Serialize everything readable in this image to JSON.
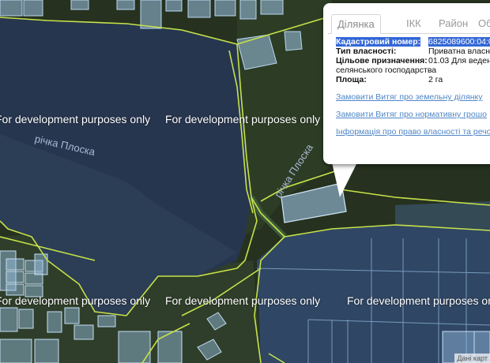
{
  "map": {
    "watermarks": [
      "For development purposes only",
      "For development purposes only",
      "For development purposes only",
      "For development purposes only",
      "For development purposes only"
    ],
    "river_labels": [
      "річка Плоска",
      "річка Плоска"
    ],
    "attribution": "Дані карт",
    "colors": {
      "parcel_fill": "#9cc3e6",
      "parcel_stroke": "#b9d7f2",
      "boundary": "#c6e24a",
      "lake": "#27364f",
      "vegetation": "#2a3a22"
    }
  },
  "popup": {
    "tabs": [
      "Ділянка",
      "ІКК",
      "Район",
      "Обл"
    ],
    "active_tab": "Ділянка",
    "fields": {
      "cadastral_label": "Кадастровий номер:",
      "cadastral_value": "6825089600:04:0",
      "ownership_label": "Тип власності:",
      "ownership_value": "Приватна власні",
      "purpose_label": "Цільове призначення:",
      "purpose_value": "01.03 Для веден",
      "purpose_cont": "селянського господарства",
      "area_label": "Площа:",
      "area_value": "2 га"
    },
    "links": [
      "Замовити Витяг про земельну ділянку",
      "Замовити Витяг про нормативну грошо",
      "Інформація про право власності та речо"
    ]
  }
}
